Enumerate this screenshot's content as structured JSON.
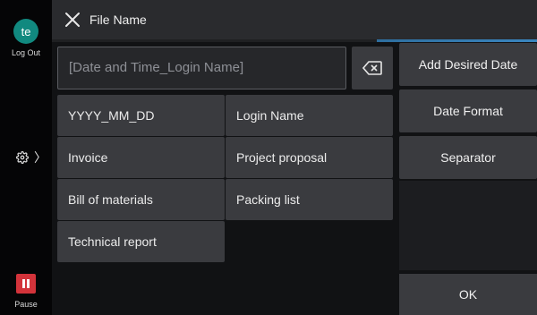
{
  "rail": {
    "avatar_initials": "te",
    "logout_label": "Log Out",
    "pause_label": "Pause",
    "settings_chevron": "〉"
  },
  "header": {
    "title": "File Name"
  },
  "input": {
    "placeholder": "[Date and Time_Login Name]"
  },
  "grid": {
    "items": [
      "YYYY_MM_DD",
      "Login Name",
      "Invoice",
      "Project proposal",
      "Bill of materials",
      "Packing list",
      "Technical report"
    ]
  },
  "side_buttons": {
    "add_desired_date": "Add Desired Date",
    "date_format": "Date Format",
    "separator": "Separator",
    "ok": "OK"
  },
  "colors": {
    "accent_blue": "#3a86c0",
    "avatar_teal": "#11897f",
    "pause_red": "#d3333a"
  }
}
